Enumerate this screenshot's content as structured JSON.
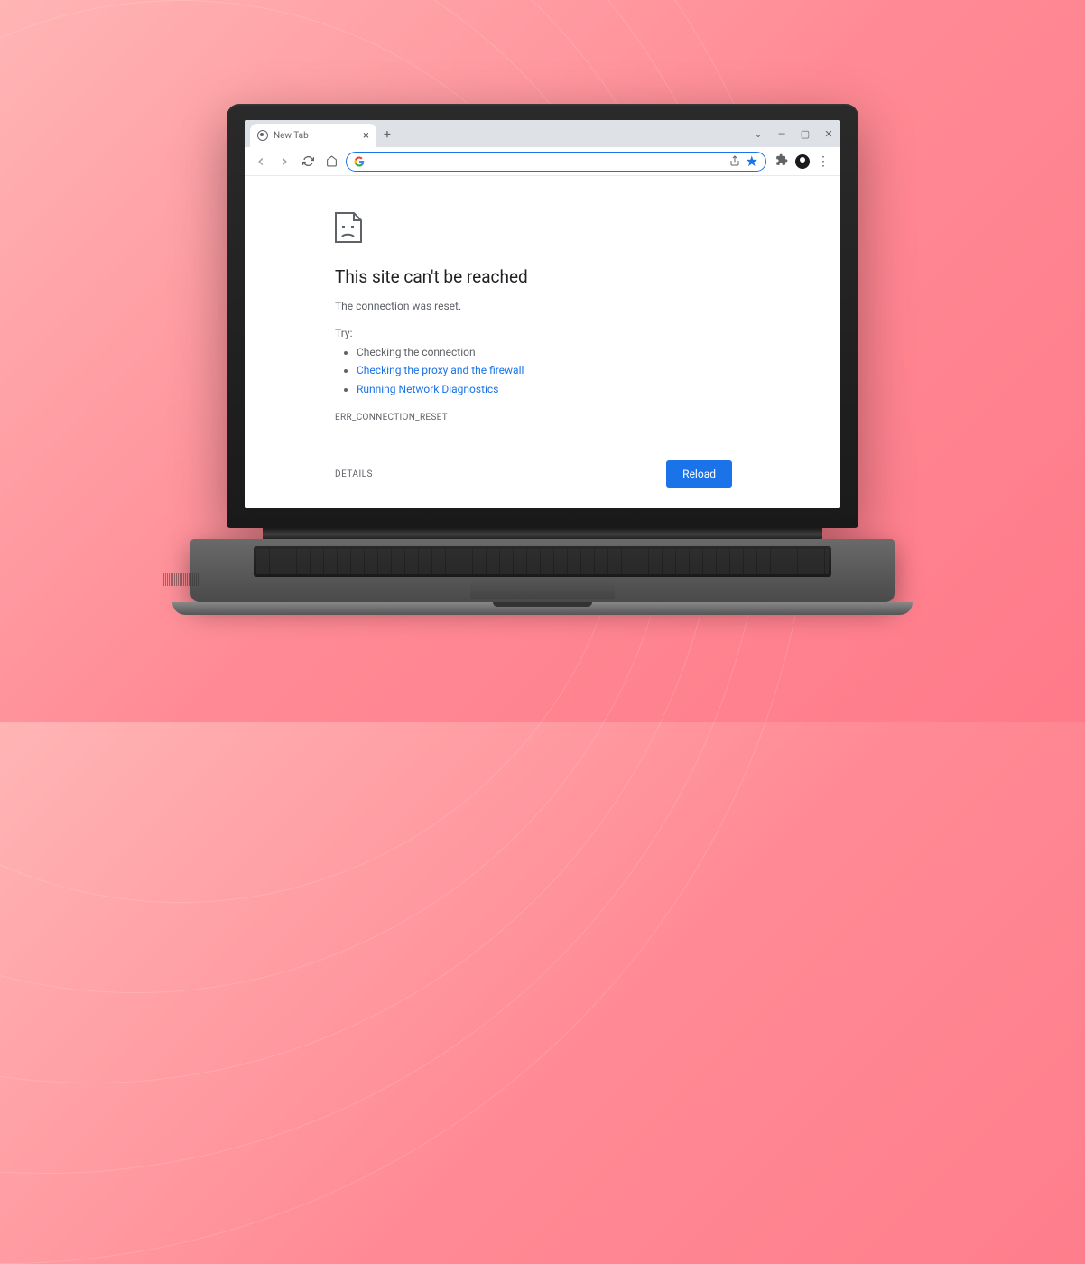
{
  "tab": {
    "title": "New Tab"
  },
  "omnibox": {
    "placeholder": ""
  },
  "error": {
    "title": "This site can't be reached",
    "subtitle": "The connection was reset.",
    "try_label": "Try:",
    "suggestions": {
      "check_connection": "Checking the connection",
      "check_proxy": "Checking the proxy and the firewall",
      "run_diagnostics": "Running Network Diagnostics"
    },
    "code": "ERR_CONNECTION_RESET",
    "details_label": "DETAILS",
    "reload_label": "Reload"
  }
}
